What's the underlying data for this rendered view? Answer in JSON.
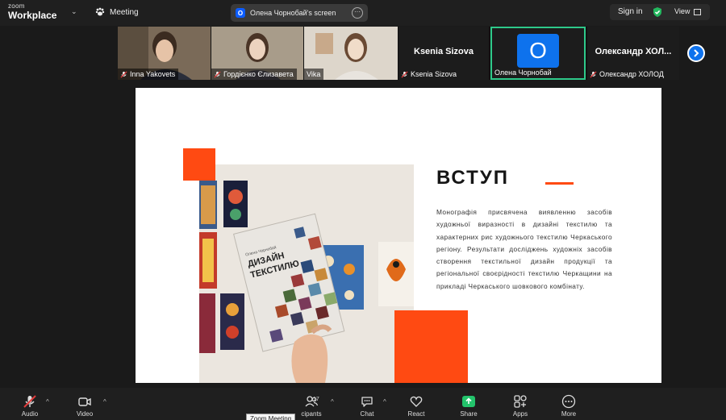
{
  "topbar": {
    "logo_line1": "zoom",
    "logo_line2": "Workplace",
    "meeting_label": "Meeting",
    "share_badge": "O",
    "share_title": "Олена Чорнобай's screen",
    "signin_label": "Sign in",
    "view_label": "View"
  },
  "participants": [
    {
      "name": "Inna Yakovets"
    },
    {
      "name": "Гордієнко Єлизавета"
    },
    {
      "name": "Vika"
    },
    {
      "name": "Ksenia Sizova",
      "display": "Ksenia Sizova"
    },
    {
      "name": "Олена Чорнобай",
      "avatar": "O"
    },
    {
      "name": "Олександр ХОЛОД",
      "display": "Олександр ХОЛ..."
    }
  ],
  "slide": {
    "title": "ВСТУП",
    "book_author": "Олена Чорнобай",
    "book_title_1": "ДИЗАЙН",
    "book_title_2": "ТЕКСТИЛЮ",
    "body": "Монографія присвячена виявленню засобів художньої виразності в дизайні текстилю та характерних рис художнього текстилю Черкаського регіону. Результати досліджень художніх засобів створення текстильної дизайн продукції та регіональної своєрідності текстилю Черкащини на прикладі Черкаського шовкового комбінату."
  },
  "toolbar": {
    "audio": "Audio",
    "video": "Video",
    "participants_count": "17",
    "participants_label": "cipants",
    "chat": "Chat",
    "react": "React",
    "share": "Share",
    "apps": "Apps",
    "more": "More",
    "tooltip": "Zoom Meeting"
  },
  "colors": {
    "accent_orange": "#ff4a12",
    "zoom_blue": "#0e72ed",
    "share_green": "#23c36b",
    "active_speaker": "#2ec98a"
  }
}
